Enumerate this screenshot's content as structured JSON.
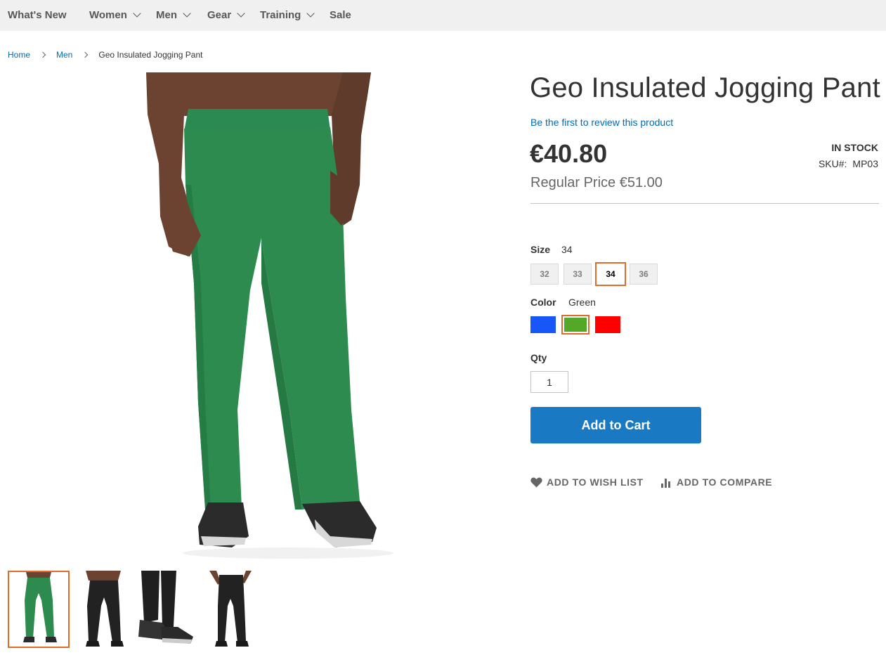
{
  "nav": {
    "items": [
      {
        "label": "What's New",
        "has_dropdown": false
      },
      {
        "label": "Women",
        "has_dropdown": true
      },
      {
        "label": "Men",
        "has_dropdown": true
      },
      {
        "label": "Gear",
        "has_dropdown": true
      },
      {
        "label": "Training",
        "has_dropdown": true
      },
      {
        "label": "Sale",
        "has_dropdown": false
      }
    ]
  },
  "breadcrumb": {
    "home": "Home",
    "men": "Men",
    "current": "Geo Insulated Jogging Pant"
  },
  "product": {
    "title": "Geo Insulated Jogging Pant",
    "review_link": "Be the first to review this product",
    "price": "€40.80",
    "regular_price": "Regular Price €51.00",
    "stock": "IN STOCK",
    "sku_label": "SKU#:",
    "sku_value": "MP03"
  },
  "options": {
    "size": {
      "label": "Size",
      "selected": "34",
      "values": [
        "32",
        "33",
        "34",
        "36"
      ]
    },
    "color": {
      "label": "Color",
      "selected": "Green",
      "swatches": [
        {
          "name": "Blue",
          "hex": "#1857f7"
        },
        {
          "name": "Green",
          "hex": "#53a828"
        },
        {
          "name": "Red",
          "hex": "#ff0000"
        }
      ]
    }
  },
  "qty": {
    "label": "Qty",
    "value": "1"
  },
  "actions": {
    "add_to_cart": "Add to Cart",
    "wishlist": "ADD TO WISH LIST",
    "compare": "ADD TO COMPARE"
  },
  "colors": {
    "accent": "#e06c2c",
    "primary_button": "#1979c3",
    "link": "#006bb4",
    "pant_green": "#2e8b4f"
  },
  "icons": {
    "wishlist": "heart-icon",
    "compare": "bar-chart-icon",
    "nav_dropdown": "chevron-down-icon",
    "breadcrumb_sep": "chevron-right-icon"
  }
}
